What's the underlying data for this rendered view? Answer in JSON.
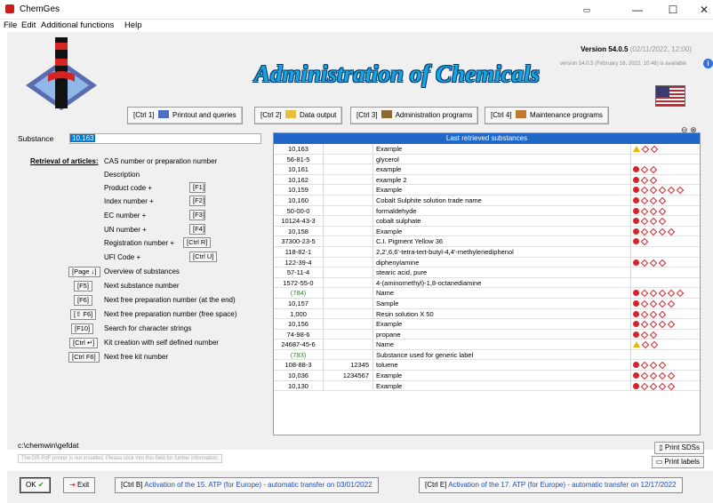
{
  "window": {
    "title": "ChemGes",
    "minimize": "—",
    "maximize": "☐",
    "close": "✕"
  },
  "menu": [
    "File",
    "Edit",
    "Additional functions",
    "Help"
  ],
  "header": {
    "title": "Administration of Chemicals",
    "version": "Version 54.0.5",
    "version_date": "(02/11/2022, 12:00)",
    "version_available": "version 54.0.5 (February 16, 2022, 10:46) is available"
  },
  "toolbar": [
    {
      "label": "[Ctrl 1]",
      "text": "Printout and queries",
      "icon": "printer-icon"
    },
    {
      "label": "[Ctrl 2]",
      "text": "Data output",
      "icon": "folder-icon"
    },
    {
      "label": "[Ctrl 3]",
      "text": "Administration programs",
      "icon": "admin-icon"
    },
    {
      "label": "[Ctrl 4]",
      "text": "Maintenance programs",
      "icon": "tools-icon"
    }
  ],
  "substance": {
    "label": "Substance",
    "value": "10,163"
  },
  "retrieval": {
    "title": "Retrieval of articles:",
    "items": [
      {
        "key": "",
        "text": "CAS number or preparation number"
      },
      {
        "key": "",
        "text": "Description"
      },
      {
        "key": "[F1]",
        "text": "Product code +"
      },
      {
        "key": "[F2]",
        "text": "Index number +"
      },
      {
        "key": "[F3]",
        "text": "EC number +"
      },
      {
        "key": "[F4]",
        "text": "UN number +"
      },
      {
        "key": "[Ctrl R]",
        "text": "Registration number +"
      },
      {
        "key": "[Ctrl U]",
        "text": "UFI Code +"
      }
    ]
  },
  "shortcuts": [
    {
      "key": "[Page ↓]",
      "text": "Overview of substances"
    },
    {
      "key": "[F5]",
      "text": "Next substance number"
    },
    {
      "key": "[F6]",
      "text": "Next free preparation number (at the end)"
    },
    {
      "key": "[⇧ F6]",
      "text": "Next free preparation number (free space)"
    },
    {
      "key": "[F10]",
      "text": "Search for character strings"
    },
    {
      "key": "[Ctrl ↵]",
      "text": "Kit creation with self defined number"
    },
    {
      "key": "[Ctrl F6]",
      "text": "Next free kit number"
    }
  ],
  "table": {
    "title": "Last retrieved substances",
    "rows": [
      {
        "id": "10,163",
        "code": "",
        "name": "Example",
        "hazards": [
          "w",
          "d",
          "d"
        ],
        "green": false
      },
      {
        "id": "56-81-5",
        "code": "",
        "name": "glycerol",
        "hazards": [],
        "green": false
      },
      {
        "id": "10,161",
        "code": "",
        "name": "example",
        "hazards": [
          "x",
          "d",
          "d"
        ],
        "green": false
      },
      {
        "id": "10,162",
        "code": "",
        "name": "example 2",
        "hazards": [
          "x",
          "d",
          "d"
        ],
        "green": false
      },
      {
        "id": "10,159",
        "code": "",
        "name": "Example",
        "hazards": [
          "x",
          "d",
          "d",
          "d",
          "d",
          "d"
        ],
        "green": false
      },
      {
        "id": "10,160",
        "code": "",
        "name": "Cobalt Sulphite solution trade name",
        "hazards": [
          "x",
          "d",
          "d",
          "d"
        ],
        "green": false
      },
      {
        "id": "50-00-0",
        "code": "",
        "name": "formaldehyde",
        "hazards": [
          "x",
          "d",
          "d",
          "d"
        ],
        "green": false
      },
      {
        "id": "10124-43-3",
        "code": "",
        "name": "cobalt sulphate",
        "hazards": [
          "x",
          "d",
          "d",
          "d"
        ],
        "green": false
      },
      {
        "id": "10,158",
        "code": "",
        "name": "Example",
        "hazards": [
          "x",
          "d",
          "d",
          "d",
          "d"
        ],
        "green": false
      },
      {
        "id": "37300-23-5",
        "code": "",
        "name": "C.I. Pigment Yellow 36",
        "hazards": [
          "x",
          "d"
        ],
        "green": false
      },
      {
        "id": "118-82-1",
        "code": "",
        "name": "2,2',6,6'-tetra-tert-butyl-4,4'-methylenediphenol",
        "hazards": [],
        "green": false
      },
      {
        "id": "122-39-4",
        "code": "",
        "name": "diphenylamine",
        "hazards": [
          "x",
          "d",
          "d",
          "d"
        ],
        "green": false
      },
      {
        "id": "57-11-4",
        "code": "",
        "name": "stearic acid, pure",
        "hazards": [],
        "green": false
      },
      {
        "id": "1572-55-0",
        "code": "",
        "name": "4-(aminomethyl)-1,8-octanediamine",
        "hazards": [],
        "green": false
      },
      {
        "id": "(784)",
        "code": "",
        "name": "Name",
        "hazards": [
          "x",
          "d",
          "d",
          "d",
          "d",
          "d"
        ],
        "green": true
      },
      {
        "id": "10,157",
        "code": "",
        "name": "Sample",
        "hazards": [
          "x",
          "d",
          "d",
          "d",
          "d"
        ],
        "green": false
      },
      {
        "id": "1,000",
        "code": "",
        "name": "Resin solution X 50",
        "hazards": [
          "x",
          "d",
          "d",
          "d"
        ],
        "green": false
      },
      {
        "id": "10,156",
        "code": "",
        "name": "Example",
        "hazards": [
          "x",
          "d",
          "d",
          "d",
          "d"
        ],
        "green": false
      },
      {
        "id": "74-98-6",
        "code": "",
        "name": "propane",
        "hazards": [
          "x",
          "d",
          "d"
        ],
        "green": false
      },
      {
        "id": "24687-45-6",
        "code": "",
        "name": "Name",
        "hazards": [
          "w",
          "d",
          "d"
        ],
        "green": false
      },
      {
        "id": "(783)",
        "code": "",
        "name": "Substance used for generic label",
        "hazards": [],
        "green": true
      },
      {
        "id": "108-88-3",
        "code": "12345",
        "name": "toluene",
        "hazards": [
          "x",
          "d",
          "d",
          "d"
        ],
        "green": false
      },
      {
        "id": "10,036",
        "code": "1234567",
        "name": "Example",
        "hazards": [
          "x",
          "d",
          "d",
          "d",
          "d"
        ],
        "green": false
      },
      {
        "id": "10,130",
        "code": "",
        "name": "Example",
        "hazards": [
          "x",
          "d",
          "d",
          "d",
          "d"
        ],
        "green": false
      }
    ]
  },
  "path": "c:\\chemwin\\gefdat",
  "printer_notice": "The DR PdF printer is not installed. Please click into this field for further information.",
  "side_buttons": {
    "print_sds": "Print SDSs",
    "print_labels": "Print labels"
  },
  "footer": {
    "ok": "OK",
    "exit": "Exit",
    "ctrl_b_key": "[Ctrl B]",
    "ctrl_b": "Activation of the 15. ATP (for Europe) - automatic transfer on 03/01/2022",
    "ctrl_e_key": "[Ctrl E]",
    "ctrl_e": "Activation of the 17. ATP (for Europe) - automatic transfer on 12/17/2022"
  }
}
